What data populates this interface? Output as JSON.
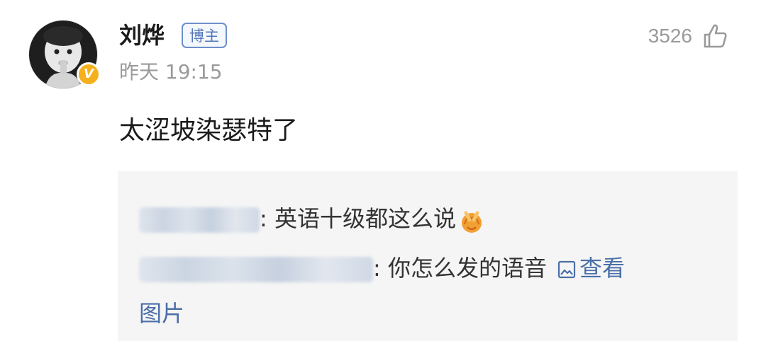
{
  "comment": {
    "author": {
      "name": "刘烨",
      "role_badge": "博主",
      "verified": true
    },
    "timestamp": "昨天 19:15",
    "like_count": "3526",
    "text": "太涩坡染瑟特了"
  },
  "replies": [
    {
      "author_hidden": true,
      "separator": ":",
      "text": "英语十级都这么说",
      "emoji": "hands-together-emoji"
    },
    {
      "author_hidden": true,
      "separator": ":",
      "text": "你怎么发的语音",
      "link": {
        "icon": "image-icon",
        "label_part1": "查看",
        "label_part2": "图片"
      }
    }
  ],
  "colors": {
    "link": "#4a6fa8",
    "verified": "#f6b01e",
    "badge_border": "#6c8fc8",
    "reply_background": "#f5f5f5",
    "meta_text": "#9a9a9a"
  }
}
